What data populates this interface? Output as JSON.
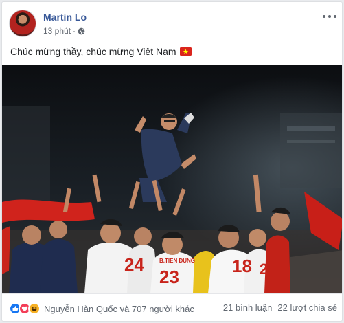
{
  "post": {
    "author": "Martin Lo",
    "time": "13 phút",
    "audience_icon": "globe-icon",
    "caption": "Chúc mừng thầy, chúc mừng Việt Nam",
    "caption_emoji": "vietnam-flag-icon"
  },
  "photo": {
    "shirt_numbers": [
      "24",
      "23",
      "18",
      "2"
    ],
    "shirt_name": "B.TIEN DUNG"
  },
  "footer": {
    "reaction_icons": [
      "like-icon",
      "love-icon",
      "haha-icon"
    ],
    "reactors": "Nguyễn Hàn Quốc và 707 người khác",
    "comments": "21 bình luận",
    "shares": "22 lượt chia sẻ"
  },
  "colors": {
    "author_link": "#385898",
    "flag_red": "#da251d",
    "flag_star": "#ffff00",
    "like": "#1877f2",
    "love": "#f33e58",
    "haha": "#f7b125"
  }
}
